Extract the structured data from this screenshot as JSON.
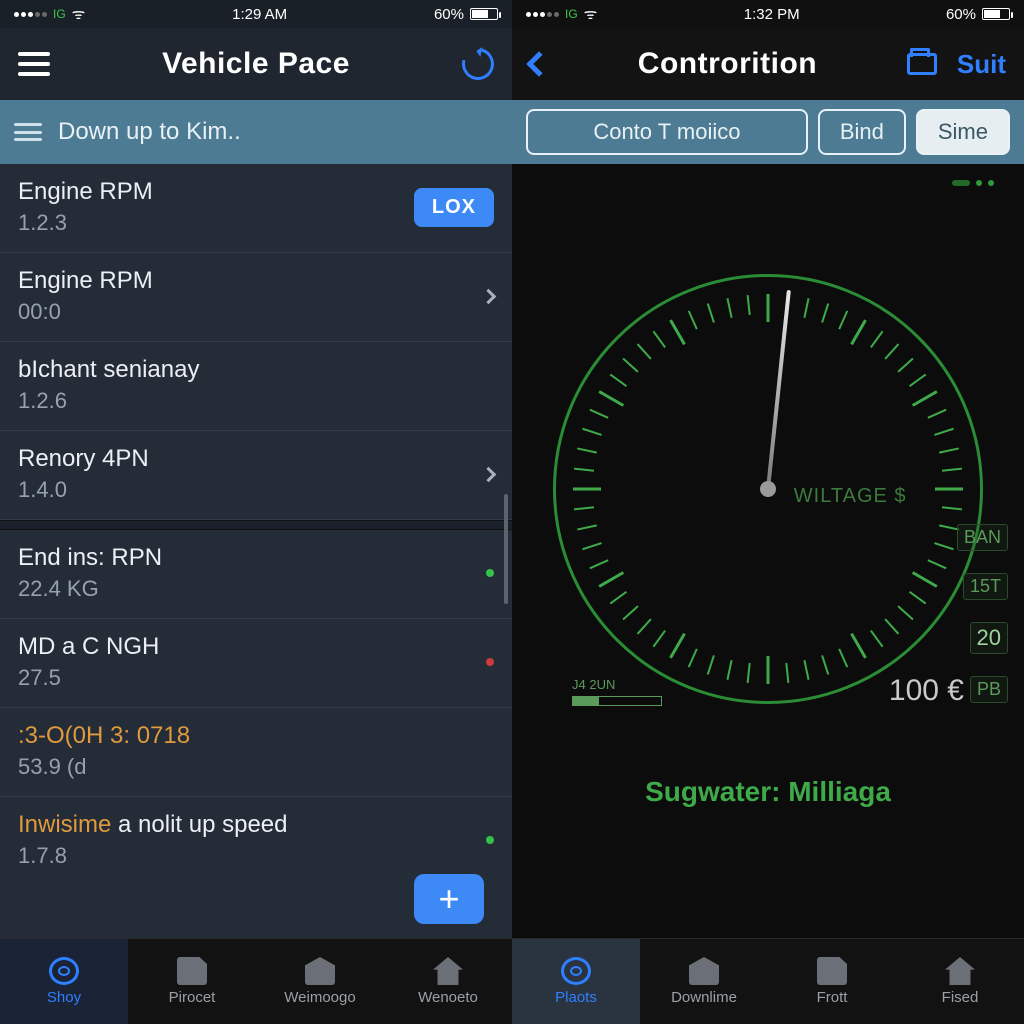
{
  "left": {
    "status": {
      "time": "1:29 AM",
      "battery": "60%"
    },
    "nav": {
      "title": "Vehicle Pace"
    },
    "sub": {
      "subtitle": "Down up to Kim.."
    },
    "rows": [
      {
        "label": "Engine RPM",
        "value": "1.2.3",
        "right": "badge",
        "badge": "LOX"
      },
      {
        "label": "Engine RPM",
        "value": "00:0",
        "right": "chev"
      },
      {
        "label": "bIchant senianay",
        "value": "1.2.6",
        "right": "none"
      },
      {
        "label": "Renory 4PN",
        "value": "1.4.0",
        "right": "chev"
      }
    ],
    "rows2": [
      {
        "label": "End ins: RPN",
        "value": "22.4 KG",
        "dot": "green"
      },
      {
        "label": "MD a C NGH",
        "value": "27.5",
        "dot": "red"
      },
      {
        "label": ":3-O(0H 3: 0718",
        "value": "53.9 (d",
        "orange": true
      },
      {
        "label_pre": "Inwisime",
        "label_post": " a nolit up speed",
        "value": "1.7.8",
        "dot": "green",
        "mixed": true
      }
    ],
    "tabs": [
      {
        "label": "Shoy",
        "active": true,
        "icon": "shoy"
      },
      {
        "label": "Pirocet",
        "icon": "doc"
      },
      {
        "label": "Weimoogo",
        "icon": "tag"
      },
      {
        "label": "Wenoeto",
        "icon": "house"
      }
    ]
  },
  "right": {
    "status": {
      "time": "1:32 PM",
      "battery": "60%"
    },
    "nav": {
      "title": "Controrition",
      "action": "Suit"
    },
    "seg": [
      {
        "label": "Conto T moiico"
      },
      {
        "label": "Bind"
      },
      {
        "label": "Sime",
        "active": true
      }
    ],
    "gauge": {
      "center_label": "WILTAGE $",
      "side": [
        "BAN",
        "15T",
        "20",
        "PB"
      ],
      "bottom_left_label": "J4 2UN",
      "price": "100 €",
      "footer_a": "Sugwater:",
      "footer_b": "Milliaga"
    },
    "tabs": [
      {
        "label": "Plaots",
        "active": true,
        "icon": "shoy"
      },
      {
        "label": "Downlime",
        "icon": "tag"
      },
      {
        "label": "Frott",
        "icon": "doc"
      },
      {
        "label": "Fised",
        "icon": "house"
      }
    ]
  }
}
